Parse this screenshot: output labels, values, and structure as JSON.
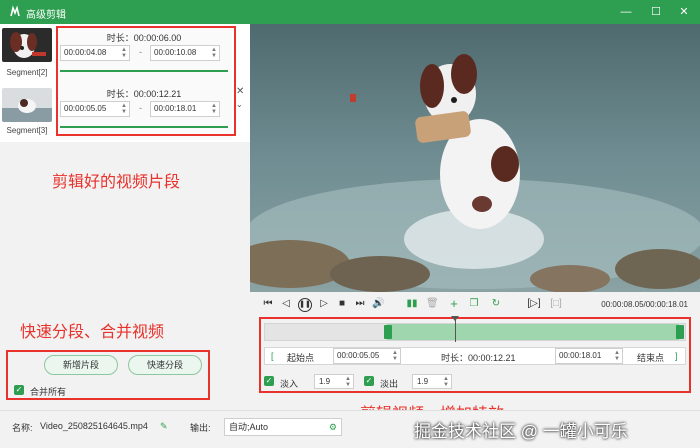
{
  "window": {
    "title": "高级剪辑",
    "minimize": "—",
    "maximize": "☐",
    "close": "✕"
  },
  "segments": [
    {
      "label": "Segment[2]",
      "duration": "时长：00:00:06.00",
      "start": "00:00:04.08",
      "end": "00:00:10.08",
      "sep": "-"
    },
    {
      "label": "Segment[3]",
      "duration": "时长：00:00:12.21",
      "start": "00:00:05.05",
      "end": "00:00:18.01",
      "sep": "-"
    }
  ],
  "annotations": {
    "clipped": "剪辑好的视频片段",
    "split_merge": "快速分段、合并视频",
    "effects": "剪辑视频，增加特效"
  },
  "left_buttons": {
    "add_segment": "新增片段",
    "quick_split": "快速分段",
    "merge_all": "合并所有"
  },
  "player": {
    "timecode": "00:00:08.05/00:00:18.01"
  },
  "trim": {
    "start_label": "起始点",
    "start_time": "00:00:05.05",
    "duration": "时长：00:00:12.21",
    "end_time": "00:00:18.01",
    "end_label": "结束点"
  },
  "fade": {
    "in_label": "淡入",
    "in_value": "1.9",
    "out_label": "淡出",
    "out_value": "1.9"
  },
  "footer": {
    "name_label": "名称:",
    "filename": "Video_250825164645.mp4",
    "output_label": "输出:",
    "output_value": "自动;Auto",
    "watermark": "掘金技术社区 @ 一罐小可乐"
  }
}
